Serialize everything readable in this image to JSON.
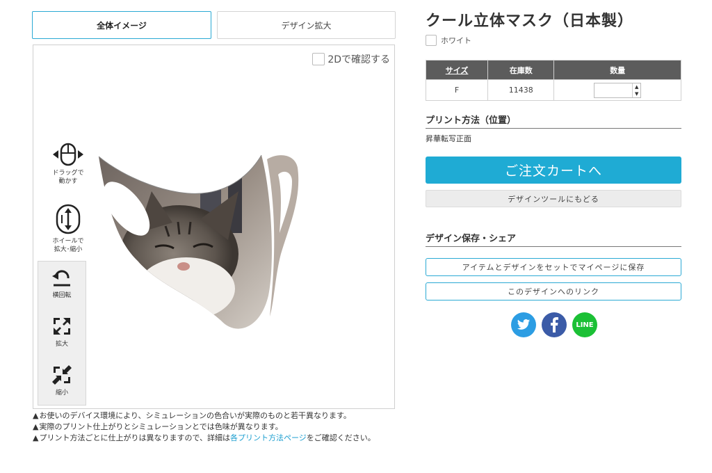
{
  "view_tabs": {
    "full": "全体イメージ",
    "zoom": "デザイン拡大"
  },
  "preview": {
    "check_2d_label": "2Dで確認する",
    "drag_hint": [
      "ドラッグで",
      "動かす"
    ],
    "wheel_hint": [
      "ホイールで",
      "拡大･縮小"
    ],
    "controls": {
      "rotate": "横回転",
      "zoom_in": "拡大",
      "zoom_out": "縮小"
    }
  },
  "notes": {
    "note1": "お使いのデバイス環境により、シミュレーションの色合いが実際のものと若干異なります。",
    "note2": "実際のプリント仕上がりとシミュレーションとでは色味が異なります。",
    "note3_before": "プリント方法ごとに仕上がりは異なりますので、詳細は",
    "note3_link": "各プリント方法ページ",
    "note3_after": "をご確認ください。"
  },
  "product": {
    "title": "クール立体マスク（日本製）",
    "color": "ホワイト"
  },
  "stock_table": {
    "headers": {
      "size": "サイズ",
      "stock": "在庫数",
      "qty": "数量"
    },
    "rows": [
      {
        "size": "F",
        "stock": "11438",
        "qty": ""
      }
    ]
  },
  "print": {
    "heading": "プリント方法（位置）",
    "method": "昇華転写正面"
  },
  "actions": {
    "cart": "ご注文カートへ",
    "back": "デザインツールにもどる"
  },
  "save_section": {
    "heading": "デザイン保存・シェア",
    "save_button": "アイテムとデザインをセットでマイページに保存",
    "link_button": "このデザインへのリンク"
  },
  "share": {
    "line": "LINE"
  },
  "colors": {
    "accent": "#1fabd4",
    "table_header": "#5c5c5c",
    "twitter": "#2c9de3",
    "facebook": "#3b5ba7",
    "line": "#1bc035"
  }
}
